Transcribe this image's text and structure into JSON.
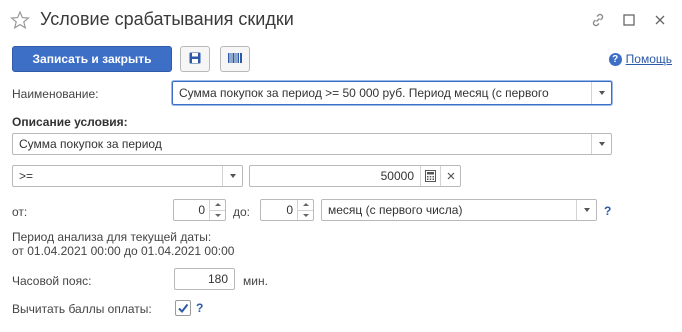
{
  "window": {
    "title": "Условие срабатывания скидки"
  },
  "toolbar": {
    "save_close_label": "Записать и закрыть",
    "help_label": "Помощь"
  },
  "form": {
    "name_label": "Наименование:",
    "name_value": "Сумма покупок за период >= 50 000 руб. Период месяц (с первого",
    "description_label": "Описание условия:",
    "condition_type_value": "Сумма покупок за период",
    "comparison_value": ">=",
    "amount_value": "50000",
    "from_label": "от:",
    "from_value": "0",
    "to_label": "до:",
    "to_value": "0",
    "period_value": "месяц (с первого числа)",
    "period_help": "?",
    "analysis_label": "Период анализа для текущей даты:",
    "analysis_range": "от 01.04.2021 00:00 до 01.04.2021 00:00",
    "timezone_label": "Часовой пояс:",
    "timezone_value": "180",
    "timezone_unit": "мин.",
    "deduct_label": "Вычитать баллы оплаты:",
    "deduct_checked": true,
    "deduct_help": "?"
  },
  "colors": {
    "primary": "#3d6fc7",
    "link": "#2c5aa6"
  }
}
